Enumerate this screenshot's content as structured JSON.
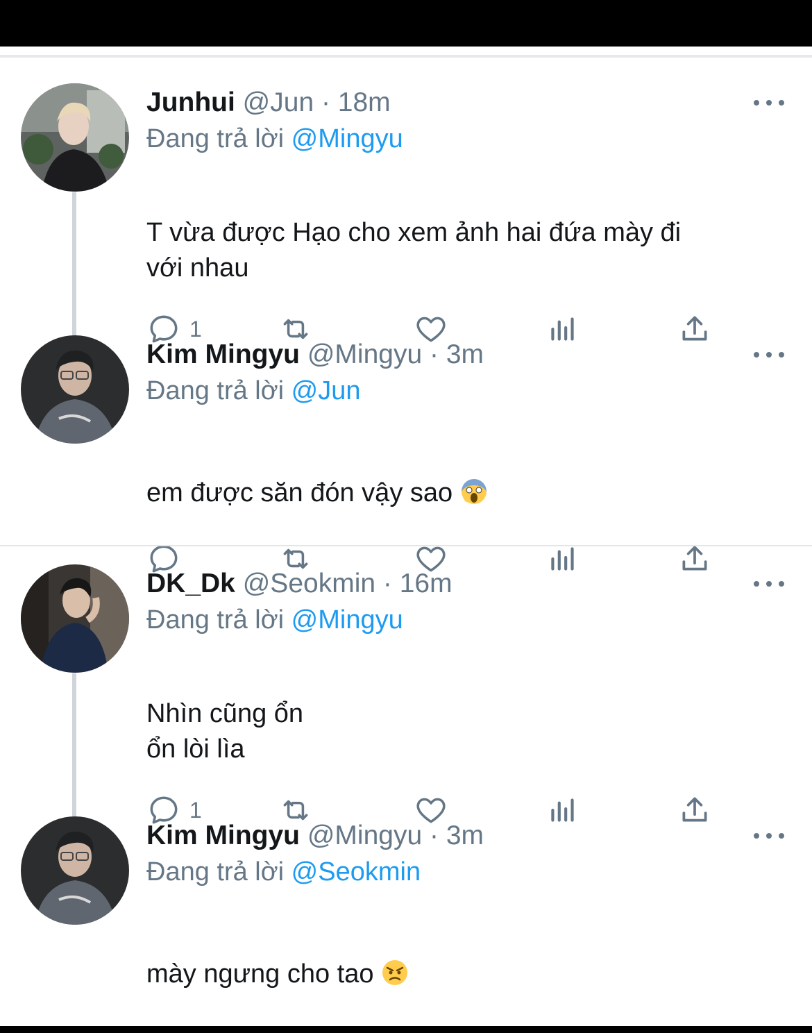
{
  "threads": [
    {
      "tweets": [
        {
          "name": "Junhui",
          "meta": "@Jun · 18m",
          "replying_prefix": "Đang trả lời",
          "replying_handle": "@Mingyu",
          "text": "T vừa được Hạo cho xem ảnh hai đứa mày đi\nvới nhau",
          "emoji": "",
          "reply_count": "1",
          "avatar_icon": "user-avatar-junhui"
        },
        {
          "name": "Kim Mingyu",
          "meta": "@Mingyu · 3m",
          "replying_prefix": "Đang trả lời",
          "replying_handle": "@Jun",
          "text": "em được săn đón vậy sao ",
          "emoji": "screaming-face-emoji",
          "reply_count": "",
          "avatar_icon": "user-avatar-mingyu"
        }
      ]
    },
    {
      "tweets": [
        {
          "name": "DK_Dk",
          "meta": "@Seokmin · 16m",
          "replying_prefix": "Đang trả lời",
          "replying_handle": "@Mingyu",
          "text": "Nhìn cũng ổn\nổn lòi lìa",
          "emoji": "",
          "reply_count": "1",
          "avatar_icon": "user-avatar-dk"
        },
        {
          "name": "Kim Mingyu",
          "meta": "@Mingyu · 3m",
          "replying_prefix": "Đang trả lời",
          "replying_handle": "@Seokmin",
          "text": "mày ngưng cho tao ",
          "emoji": "angry-face-emoji",
          "reply_count": "",
          "avatar_icon": "user-avatar-mingyu"
        }
      ]
    }
  ],
  "icons": {
    "reply": "reply-icon",
    "retweet": "retweet-icon",
    "like": "heart-icon",
    "views": "analytics-icon",
    "share": "share-icon",
    "more": "more-icon"
  },
  "colors": {
    "link": "#1d9bf0",
    "muted": "#657786",
    "text": "#14171a"
  }
}
